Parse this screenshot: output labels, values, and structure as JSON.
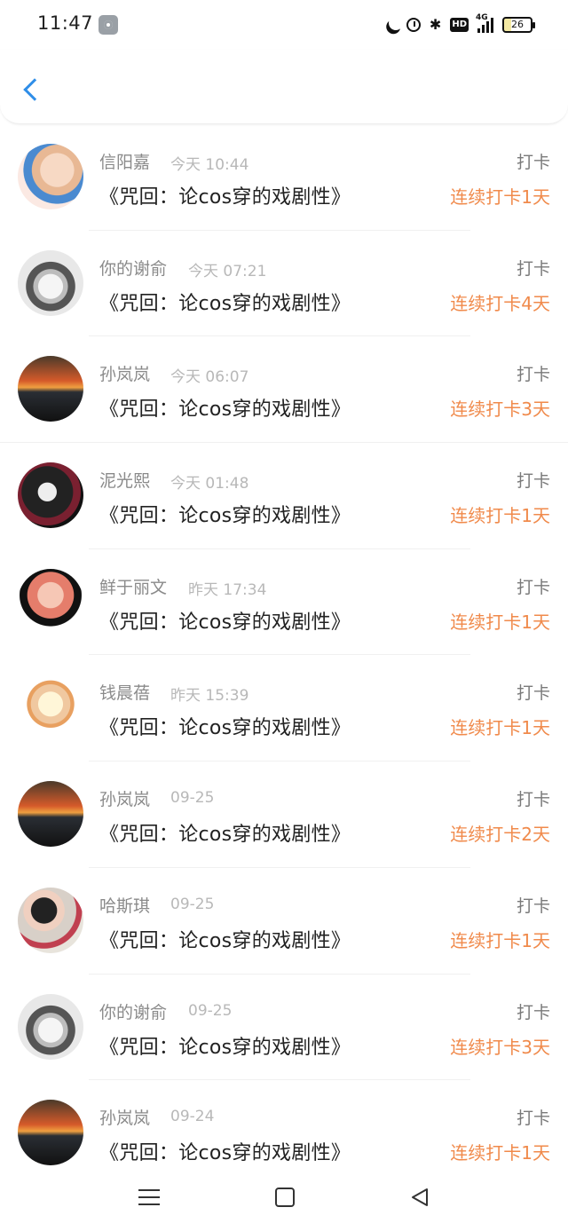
{
  "status_bar": {
    "time": "11:47",
    "network": "4G",
    "hd_label": "HD",
    "battery": "26"
  },
  "header": {
    "back_icon": "chevron-left-icon"
  },
  "checkins": [
    {
      "name": "信阳嘉",
      "time": "今天 10:44",
      "title": "《咒回：论cos穿的戏剧性》",
      "action": "打卡",
      "streak": "连续打卡1天"
    },
    {
      "name": "你的谢俞",
      "time": "今天 07:21",
      "title": "《咒回：论cos穿的戏剧性》",
      "action": "打卡",
      "streak": "连续打卡4天"
    },
    {
      "name": "孙岚岚",
      "time": "今天 06:07",
      "title": "《咒回：论cos穿的戏剧性》",
      "action": "打卡",
      "streak": "连续打卡3天"
    },
    {
      "name": "泥光熙",
      "time": "今天 01:48",
      "title": "《咒回：论cos穿的戏剧性》",
      "action": "打卡",
      "streak": "连续打卡1天"
    },
    {
      "name": "鲜于丽文",
      "time": "昨天 17:34",
      "title": "《咒回：论cos穿的戏剧性》",
      "action": "打卡",
      "streak": "连续打卡1天"
    },
    {
      "name": "钱晨蓓",
      "time": "昨天 15:39",
      "title": "《咒回：论cos穿的戏剧性》",
      "action": "打卡",
      "streak": "连续打卡1天"
    },
    {
      "name": "孙岚岚",
      "time": "09-25",
      "title": "《咒回：论cos穿的戏剧性》",
      "action": "打卡",
      "streak": "连续打卡2天"
    },
    {
      "name": "哈斯琪",
      "time": "09-25",
      "title": "《咒回：论cos穿的戏剧性》",
      "action": "打卡",
      "streak": "连续打卡1天"
    },
    {
      "name": "你的谢俞",
      "time": "09-25",
      "title": "《咒回：论cos穿的戏剧性》",
      "action": "打卡",
      "streak": "连续打卡3天"
    },
    {
      "name": "孙岚岚",
      "time": "09-24",
      "title": "《咒回：论cos穿的戏剧性》",
      "action": "打卡",
      "streak": "连续打卡1天"
    }
  ],
  "colors": {
    "accent": "#2f8ee8",
    "streak": "#f08a4b"
  }
}
